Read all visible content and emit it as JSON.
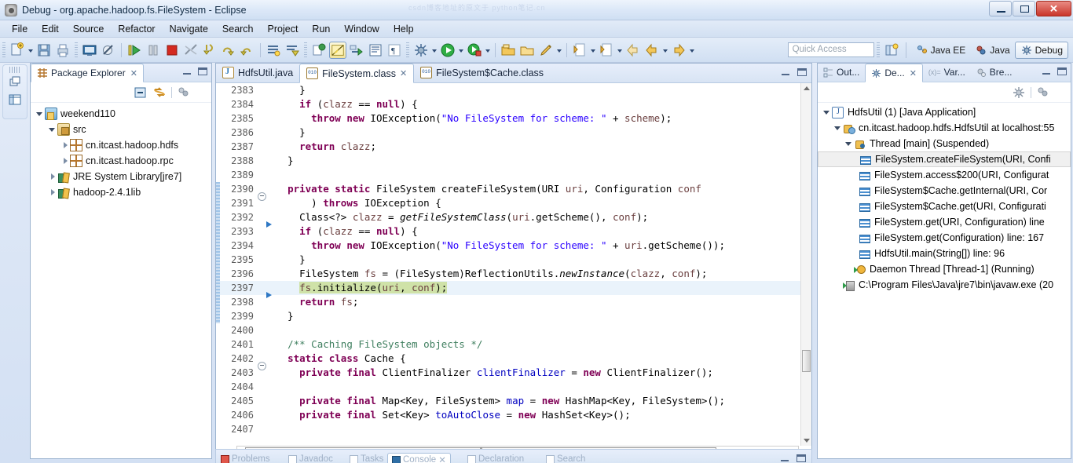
{
  "window": {
    "title": "Debug - org.apache.hadoop.fs.FileSystem - Eclipse",
    "ghost_watermark": "csdn博客地址的原文于 python笔记.cn",
    "controls": {
      "minimize": "minimize-icon",
      "restore": "restore-icon",
      "close": "✕"
    }
  },
  "menu": {
    "items": [
      "File",
      "Edit",
      "Source",
      "Refactor",
      "Navigate",
      "Search",
      "Project",
      "Run",
      "Window",
      "Help"
    ]
  },
  "toolbar": {
    "quick_access_placeholder": "Quick Access",
    "groups": [
      {
        "name": "file-group",
        "icons": [
          "new-wizard-icon",
          "new-dropdown-arrow",
          "save-icon",
          "print-icon"
        ]
      },
      {
        "name": "view-group",
        "icons": [
          "open-console-icon",
          "skip-breakpoints-icon"
        ]
      },
      {
        "name": "debug-control-group",
        "icons": [
          "resume-icon",
          "suspend-icon",
          "terminate-icon",
          "disconnect-icon",
          "step-into-icon",
          "step-over-icon",
          "step-return-icon"
        ]
      },
      {
        "name": "misc-group",
        "icons": [
          "collapse-all-icon",
          "drop-to-frame-icon"
        ]
      },
      {
        "name": "marker-group",
        "icons": [
          "toggle-breakpoint-icon",
          "highlight-icon",
          "link-icon",
          "block-selection-icon",
          "show-whitespace-icon"
        ]
      },
      {
        "name": "run-group",
        "icons": [
          "debug-bug-icon",
          "debug-dropdown-arrow",
          "run-play-icon",
          "run-dropdown-arrow",
          "external-tools-icon",
          "external-dropdown-arrow"
        ]
      },
      {
        "name": "search-group",
        "icons": [
          "open-type-icon",
          "open-task-icon",
          "search-icon",
          "search-dropdown-arrow"
        ]
      },
      {
        "name": "nav-group",
        "icons": [
          "next-annotation-icon",
          "next-dropdown-arrow",
          "previous-edit-icon",
          "prev-dropdown-arrow",
          "back-arrow-icon",
          "back-dropdown-arrow",
          "forward-arrow-icon",
          "forward-dropdown-arrow"
        ]
      }
    ],
    "perspectives": {
      "open_perspective_icon": "open-perspective-icon",
      "items": [
        {
          "label": "Java EE",
          "icon": "java-ee-perspective-icon",
          "active": false
        },
        {
          "label": "Java",
          "icon": "java-perspective-icon",
          "active": false
        },
        {
          "label": "Debug",
          "icon": "debug-perspective-icon",
          "active": true
        }
      ]
    }
  },
  "package_explorer": {
    "tab_label": "Package Explorer",
    "tab_icon": "package-explorer-icon",
    "close_glyph": "✕",
    "toolbar_icons": [
      "collapse-all-icon",
      "link-with-editor-icon",
      "view-filters-icon",
      "view-menu-icon"
    ],
    "tree": [
      {
        "label": "weekend110",
        "icon": "java-project-icon",
        "indent": 0,
        "expanded": true
      },
      {
        "label": "src",
        "icon": "source-folder-icon",
        "indent": 1,
        "expanded": true
      },
      {
        "label": "cn.itcast.hadoop.hdfs",
        "icon": "package-icon",
        "indent": 2,
        "expanded": false
      },
      {
        "label": "cn.itcast.hadoop.rpc",
        "icon": "package-icon",
        "indent": 2,
        "expanded": false
      },
      {
        "label": "JRE System Library",
        "suffix": " [jre7]",
        "icon": "library-icon",
        "indent": 1,
        "expanded": false
      },
      {
        "label": "hadoop-2.4.1lib",
        "icon": "library-icon",
        "indent": 1,
        "expanded": false
      }
    ]
  },
  "editor": {
    "tabs": [
      {
        "label": "HdfsUtil.java",
        "icon": "java-file-icon",
        "active": false,
        "closable": false
      },
      {
        "label": "FileSystem.class",
        "icon": "class-file-icon",
        "active": true,
        "closable": true,
        "close_glyph": "✕"
      },
      {
        "label": "FileSystem$Cache.class",
        "icon": "class-file-icon",
        "active": false,
        "closable": false
      }
    ],
    "header_icons": [
      "minimize-view-icon",
      "maximize-view-icon"
    ],
    "current_line": 2397,
    "lines": [
      {
        "n": 2383,
        "fold": false,
        "mark": "",
        "html": "    }"
      },
      {
        "n": 2384,
        "fold": false,
        "mark": "",
        "html": "    <k>if</k> (<l>clazz</l> == <k>null</k>) {"
      },
      {
        "n": 2385,
        "fold": false,
        "mark": "",
        "html": "      <k>throw</k> <k>new</k> IOException(<s>\"No FileSystem for scheme: \"</s> + <l>scheme</l>);"
      },
      {
        "n": 2386,
        "fold": false,
        "mark": "",
        "html": "    }"
      },
      {
        "n": 2387,
        "fold": false,
        "mark": "",
        "html": "    <k>return</k> <l>clazz</l>;"
      },
      {
        "n": 2388,
        "fold": false,
        "mark": "",
        "html": "  }"
      },
      {
        "n": 2389,
        "fold": false,
        "mark": "",
        "html": ""
      },
      {
        "n": 2390,
        "fold": true,
        "mark": "",
        "html": "  <k>private</k> <k>static</k> FileSystem createFileSystem(URI <l>uri</l>, Configuration <l>conf</l>"
      },
      {
        "n": 2391,
        "fold": false,
        "mark": "",
        "html": "      ) <k>throws</k> IOException {"
      },
      {
        "n": 2392,
        "fold": false,
        "mark": "arrow",
        "html": "    Class&lt;?&gt; <l>clazz</l> = <i>getFileSystemClass</i>(<l>uri</l>.getScheme(), <l>conf</l>);"
      },
      {
        "n": 2393,
        "fold": false,
        "mark": "",
        "html": "    <k>if</k> (<l>clazz</l> == <k>null</k>) {"
      },
      {
        "n": 2394,
        "fold": false,
        "mark": "",
        "html": "      <k>throw</k> <k>new</k> IOException(<s>\"No FileSystem for scheme: \"</s> + <l>uri</l>.getScheme());"
      },
      {
        "n": 2395,
        "fold": false,
        "mark": "",
        "html": "    }"
      },
      {
        "n": 2396,
        "fold": false,
        "mark": "",
        "html": "    FileSystem <l>fs</l> = (FileSystem)ReflectionUtils.<i>newInstance</i>(<l>clazz</l>, <l>conf</l>);"
      },
      {
        "n": 2397,
        "fold": false,
        "mark": "arrow",
        "current": true,
        "html": "    <hl><l>fs</l>.initialize(<l>uri</l>, <l>conf</l>);</hl>"
      },
      {
        "n": 2398,
        "fold": false,
        "mark": "",
        "html": "    <k>return</k> <l>fs</l>;"
      },
      {
        "n": 2399,
        "fold": false,
        "mark": "",
        "html": "  }"
      },
      {
        "n": 2400,
        "fold": false,
        "mark": "",
        "html": ""
      },
      {
        "n": 2401,
        "fold": false,
        "mark": "",
        "html": "  <c>/** Caching FileSystem objects */</c>"
      },
      {
        "n": 2402,
        "fold": true,
        "mark": "",
        "html": "  <k>static</k> <k>class</k> Cache {"
      },
      {
        "n": 2403,
        "fold": false,
        "mark": "",
        "html": "    <k>private</k> <k>final</k> ClientFinalizer <f>clientFinalizer</f> = <k>new</k> ClientFinalizer();"
      },
      {
        "n": 2404,
        "fold": false,
        "mark": "",
        "html": ""
      },
      {
        "n": 2405,
        "fold": false,
        "mark": "",
        "html": "    <k>private</k> <k>final</k> Map&lt;Key, FileSystem&gt; <f>map</f> = <k>new</k> HashMap&lt;Key, FileSystem&gt;();"
      },
      {
        "n": 2406,
        "fold": false,
        "mark": "",
        "html": "    <k>private</k> <k>final</k> Set&lt;Key&gt; <f>toAutoClose</f> = <k>new</k> HashSet&lt;Key&gt;();"
      },
      {
        "n": 2407,
        "fold": false,
        "mark": "",
        "html": ""
      }
    ],
    "scrollbars": {
      "vertical": "editor-vertical-scrollbar",
      "horizontal": "editor-horizontal-scrollbar"
    }
  },
  "debug_view": {
    "tabs": [
      {
        "label": "Out...",
        "icon": "outline-icon",
        "active": false
      },
      {
        "label": "De...",
        "icon": "debug-icon",
        "active": true,
        "close_glyph": "✕"
      },
      {
        "label": "Var...",
        "icon": "variables-icon",
        "active": false
      },
      {
        "label": "Bre...",
        "icon": "breakpoints-icon",
        "active": false
      }
    ],
    "header_icons": [
      "minimize-view-icon",
      "maximize-view-icon"
    ],
    "toolbar_icons": [
      "debug-perspective-small-icon",
      "view-filters-icon",
      "view-menu-icon"
    ],
    "tree": [
      {
        "label": "HdfsUtil (1) [Java Application]",
        "icon": "launch-icon",
        "indent": 0,
        "expanded": true
      },
      {
        "label": "cn.itcast.hadoop.hdfs.HdfsUtil at localhost:55",
        "icon": "vm-icon",
        "indent": 1,
        "expanded": true
      },
      {
        "label": "Thread [main] (Suspended)",
        "icon": "thread-icon",
        "indent": 2,
        "expanded": true
      },
      {
        "label": "FileSystem.createFileSystem(URI, Confi",
        "icon": "stack-frame-icon",
        "indent": 3,
        "selected": true
      },
      {
        "label": "FileSystem.access$200(URI, Configurat",
        "icon": "stack-frame-icon",
        "indent": 3
      },
      {
        "label": "FileSystem$Cache.getInternal(URI, Cor",
        "icon": "stack-frame-icon",
        "indent": 3
      },
      {
        "label": "FileSystem$Cache.get(URI, Configurati",
        "icon": "stack-frame-icon",
        "indent": 3
      },
      {
        "label": "FileSystem.get(URI, Configuration) line",
        "icon": "stack-frame-icon",
        "indent": 3
      },
      {
        "label": "FileSystem.get(Configuration) line: 167",
        "icon": "stack-frame-icon",
        "indent": 3
      },
      {
        "label": "HdfsUtil.main(String[]) line: 96",
        "icon": "stack-frame-icon",
        "indent": 3
      },
      {
        "label": "Daemon Thread [Thread-1] (Running)",
        "icon": "daemon-thread-icon",
        "indent": 2
      },
      {
        "label": "C:\\Program Files\\Java\\jre7\\bin\\javaw.exe (20",
        "icon": "process-icon",
        "indent": 1
      }
    ]
  },
  "bottom_panel": {
    "tabs": [
      {
        "label": "Problems",
        "icon": "problems-icon",
        "active": false
      },
      {
        "label": "Javadoc",
        "icon": "javadoc-icon",
        "active": false
      },
      {
        "label": "Tasks",
        "icon": "tasks-icon",
        "active": false
      },
      {
        "label": "Console",
        "icon": "console-icon",
        "active": true,
        "close_glyph": "✕"
      },
      {
        "label": "Declaration",
        "icon": "declaration-icon",
        "active": false
      },
      {
        "label": "Search",
        "icon": "search-icon",
        "active": false
      }
    ],
    "header_icons": [
      "minimize-view-icon",
      "maximize-view-icon"
    ]
  },
  "left_minibar": {
    "icons": [
      "restore-view-icon",
      "package-explorer-mini-icon"
    ]
  },
  "colors": {
    "keyword": "#7f0055",
    "string": "#2a00ff",
    "comment": "#3f7f5f",
    "field": "#0000c0",
    "current_line_highlight": "#cfe2a8",
    "current_row_background": "#eaf3fb",
    "chrome": "#d6e2f5",
    "close_button": "#c9362b"
  }
}
